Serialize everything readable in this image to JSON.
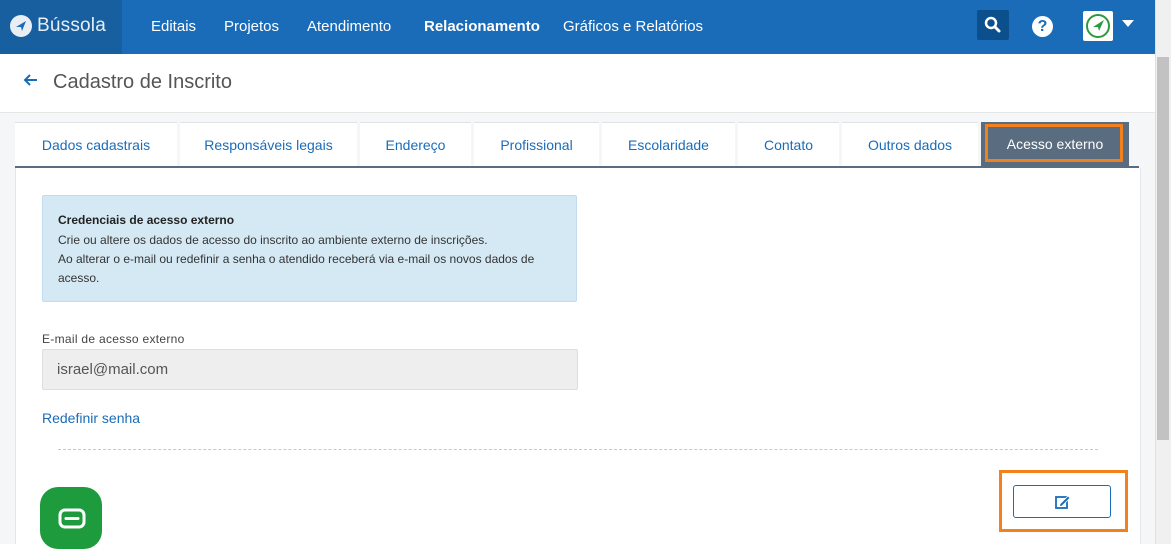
{
  "app": {
    "name": "Bússola"
  },
  "nav": {
    "items": [
      {
        "label": "Editais",
        "active": false
      },
      {
        "label": "Projetos",
        "active": false
      },
      {
        "label": "Atendimento",
        "active": false
      },
      {
        "label": "Relacionamento",
        "active": true
      },
      {
        "label": "Gráficos e Relatórios",
        "active": false
      }
    ],
    "search_icon": "search-icon",
    "help_label": "?"
  },
  "page": {
    "title": "Cadastro de Inscrito"
  },
  "tabs": [
    {
      "label": "Dados cadastrais"
    },
    {
      "label": "Responsáveis legais"
    },
    {
      "label": "Endereço"
    },
    {
      "label": "Profissional"
    },
    {
      "label": "Escolaridade"
    },
    {
      "label": "Contato"
    },
    {
      "label": "Outros dados"
    },
    {
      "label": "Acesso externo",
      "active": true
    }
  ],
  "info": {
    "title": "Credenciais de acesso externo",
    "line1": "Crie ou altere os dados de acesso do inscrito ao ambiente externo de inscrições.",
    "line2": "Ao alterar o e-mail ou redefinir a senha o atendido receberá via e-mail os novos dados de",
    "line3": "acesso."
  },
  "form": {
    "email_label": "E-mail de acesso externo",
    "email_value": "israel@mail.com",
    "reset_link": "Redefinir senha"
  },
  "colors": {
    "primary": "#1b6cb8",
    "highlight": "#f2811d",
    "active_tab": "#5a6d80",
    "chat": "#1e9b3d"
  }
}
